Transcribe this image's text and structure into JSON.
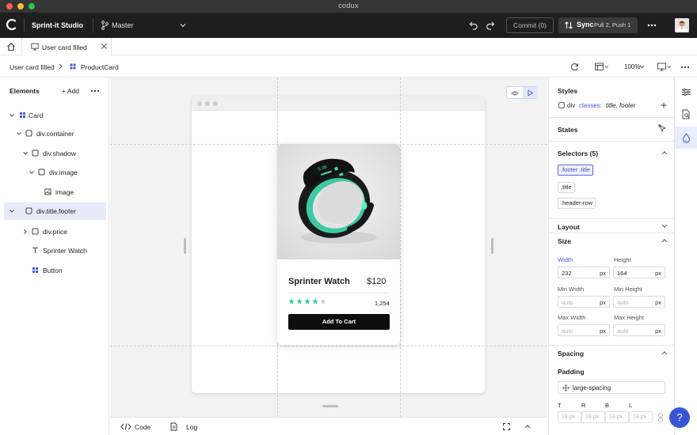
{
  "window": {
    "title": "codux"
  },
  "colors": {
    "accent": "#3a54d6",
    "selection_bg": "#e7ebf9",
    "chip_active": "#5b6bd6",
    "teal": "#3ec9a0",
    "traffic_red": "#ff5f57",
    "traffic_yellow": "#febc2e",
    "traffic_green": "#28c840"
  },
  "toolbar": {
    "project": "Sprint-it Studio",
    "branch": "Master",
    "commit_label": "Commit (0)",
    "sync_label": "Sync",
    "sync_detail": "Pull 2, Push 1"
  },
  "tabs": [
    {
      "label": "User card filled"
    }
  ],
  "breadcrumb": {
    "parent": "User card filled",
    "current": "ProductCard",
    "zoom": "100%"
  },
  "elements_panel": {
    "title": "Elements",
    "add_label": "+ Add",
    "tree": [
      {
        "label": "Card",
        "icon": "component-icon",
        "selected": false
      },
      {
        "label": "div.container",
        "icon": "box-icon",
        "selected": false
      },
      {
        "label": "div.shadow",
        "icon": "box-icon",
        "selected": false
      },
      {
        "label": "div.image",
        "icon": "box-icon",
        "selected": false
      },
      {
        "label": "image",
        "icon": "image-icon",
        "selected": false
      },
      {
        "label": "div.title.footer",
        "icon": "box-icon",
        "selected": true
      },
      {
        "label": "div.price",
        "icon": "box-icon",
        "selected": false
      },
      {
        "label": "Sprinter Watch",
        "icon": "text-icon",
        "selected": false
      },
      {
        "label": "Button",
        "icon": "component-icon",
        "selected": false
      }
    ]
  },
  "product_card": {
    "title": "Sprinter Watch",
    "price": "$120",
    "rating": 4,
    "rating_max": 5,
    "reviews": "1,254",
    "button_label": "Add To Cart"
  },
  "bottom_bar": {
    "code_label": "Code",
    "log_label": "Log"
  },
  "styles_panel": {
    "styles_title": "Styles",
    "element": "div",
    "classes_label": "classes:",
    "classes_value": "title, footer",
    "states_title": "States",
    "selectors_title": "Selectors (5)",
    "selectors": [
      ".footer .title",
      ".title",
      ".header-row"
    ],
    "layout_title": "Layout",
    "size_title": "Size",
    "size": {
      "width_label": "Width",
      "width": "232",
      "width_unit": "px",
      "height_label": "Height",
      "height": "164",
      "height_unit": "px",
      "min_width_label": "Min Width",
      "min_width": "auto",
      "min_width_unit": "px",
      "min_height_label": "Min Height",
      "min_height": "auto",
      "min_height_unit": "px",
      "max_width_label": "Max Width",
      "max_width": "auto",
      "max_width_unit": "px",
      "max_height_label": "Max Height",
      "max_height": "auto",
      "max_height_unit": "px"
    },
    "spacing_title": "Spacing",
    "padding_title": "Padding",
    "padding_preset": "large-spacing",
    "padding_sides": [
      {
        "label": "T",
        "value": "18 px"
      },
      {
        "label": "R",
        "value": "18 px"
      },
      {
        "label": "B",
        "value": "18 px"
      },
      {
        "label": "L",
        "value": "18 px"
      }
    ]
  },
  "help": {
    "label": "?"
  }
}
